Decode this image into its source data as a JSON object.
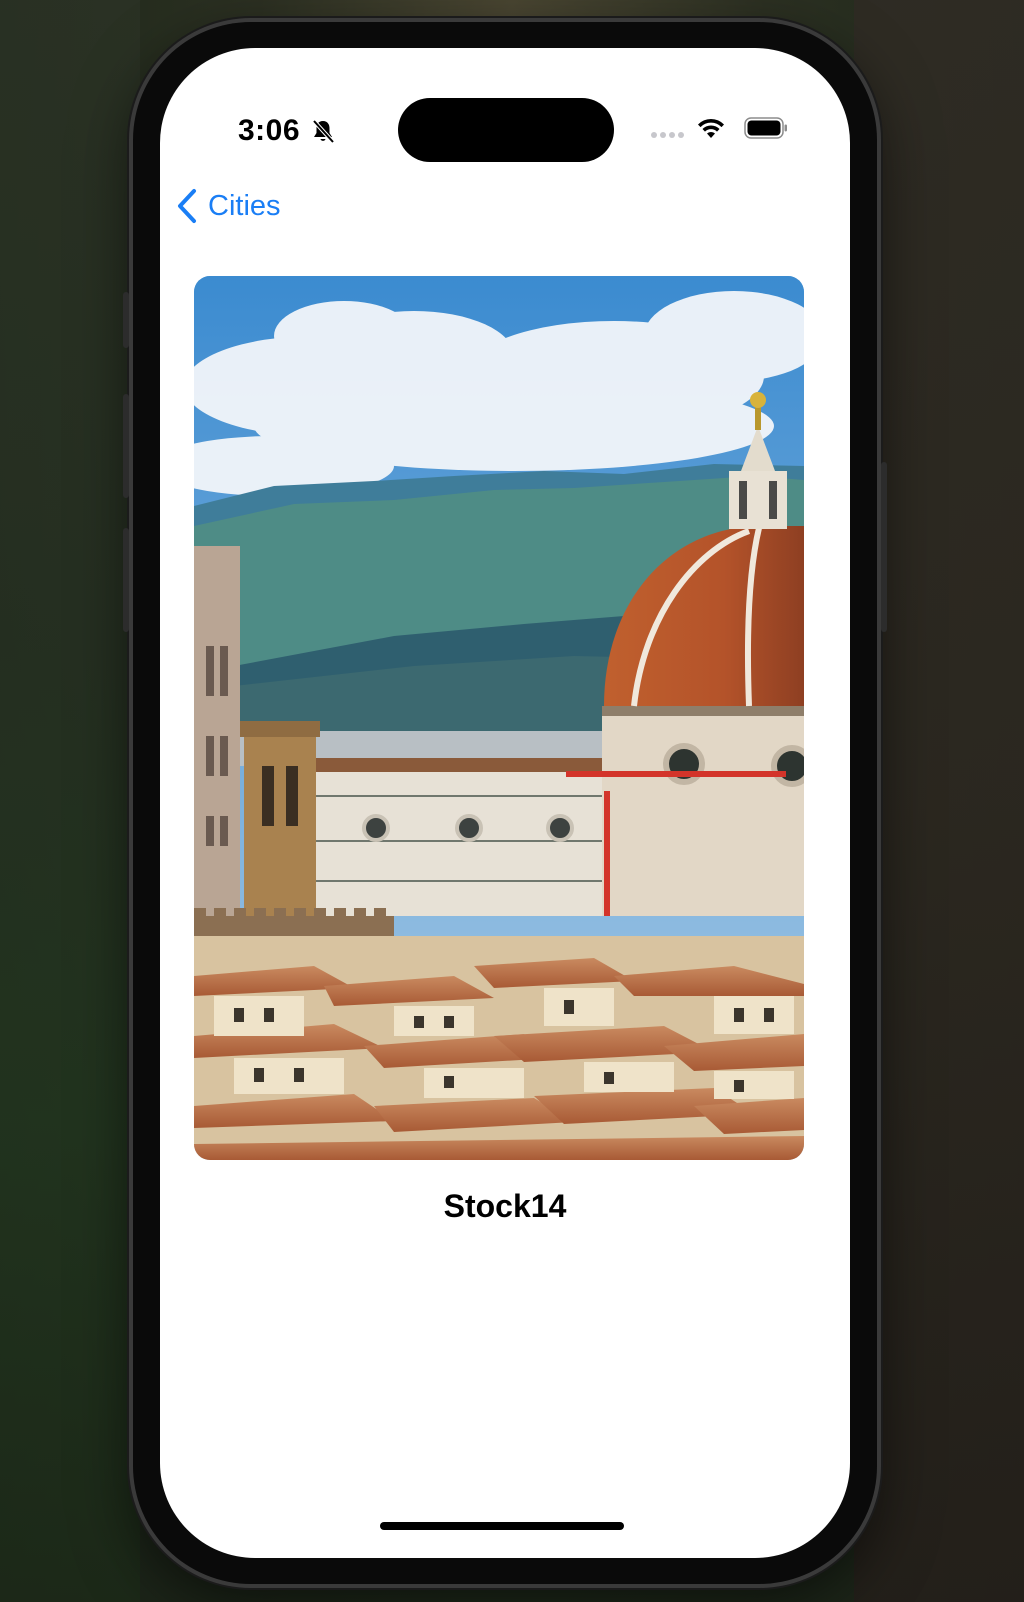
{
  "status_bar": {
    "time": "3:06",
    "silent_icon": "bell-slash-icon",
    "signal_icon": "cellular-signal-icon",
    "wifi_icon": "wifi-icon",
    "battery_icon": "battery-icon"
  },
  "nav": {
    "back_label": "Cities",
    "back_icon": "chevron-left-icon",
    "accent_color": "#1a7ef5"
  },
  "detail": {
    "image_alt": "Florence cathedral dome over city rooftops",
    "title": "Stock14"
  }
}
